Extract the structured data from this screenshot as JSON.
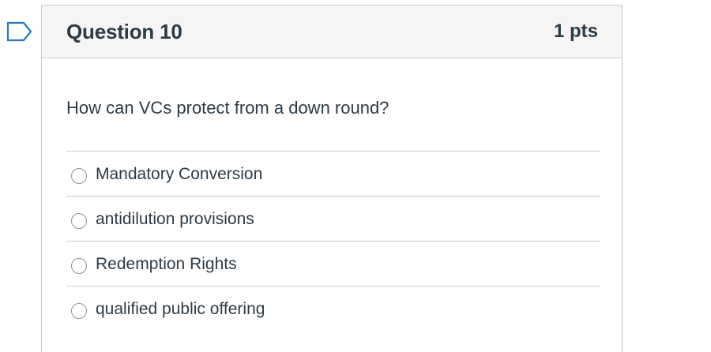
{
  "question": {
    "title": "Question 10",
    "points": "1 pts",
    "text": "How can VCs protect from a down round?",
    "flag_icon": "flag-outline-icon",
    "answers": [
      {
        "label": "Mandatory Conversion",
        "selected": false
      },
      {
        "label": "antidilution provisions",
        "selected": false
      },
      {
        "label": "Redemption Rights",
        "selected": false
      },
      {
        "label": "qualified public offering",
        "selected": false
      }
    ]
  },
  "colors": {
    "header_bg": "#f5f5f5",
    "border": "#c7cdd1",
    "text": "#2d3b45",
    "flag": "#2b7abc"
  }
}
